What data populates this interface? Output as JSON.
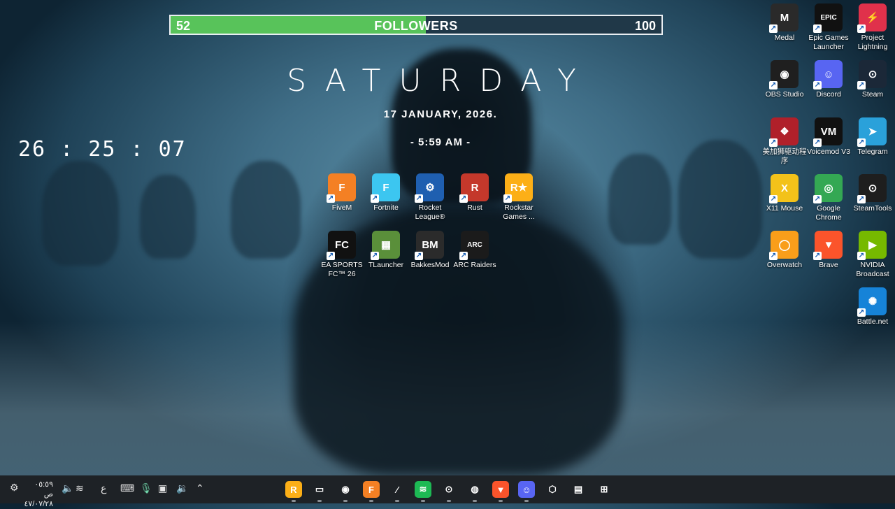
{
  "followers": {
    "current": "52",
    "label": "FOLLOWERS",
    "goal": "100",
    "progress": 0.52
  },
  "widget": {
    "day": "SATURDAY",
    "date": "17 JANUARY, 2026.",
    "time": "- 5:59 AM -"
  },
  "counter": "26 : 25 : 07",
  "center_icons": [
    {
      "label": "FiveM",
      "icon": "fivem-icon",
      "color": "#f48024",
      "glyph": "F"
    },
    {
      "label": "Fortnite",
      "icon": "fortnite-icon",
      "color": "#3cc6f0",
      "glyph": "F"
    },
    {
      "label": "Rocket League®",
      "icon": "rocket-league-icon",
      "color": "#1f5fb0",
      "glyph": "⚙"
    },
    {
      "label": "Rust",
      "icon": "rust-icon",
      "color": "#c4382b",
      "glyph": "R"
    },
    {
      "label": "Rockstar Games ...",
      "icon": "rockstar-icon",
      "color": "#fcaf17",
      "glyph": "R★"
    },
    {
      "label": "EA SPORTS FC™ 26",
      "icon": "ea-fc-icon",
      "color": "#111111",
      "glyph": "FC"
    },
    {
      "label": "TLauncher",
      "icon": "tlauncher-icon",
      "color": "#5a8f3a",
      "glyph": "▦"
    },
    {
      "label": "BakkesMod",
      "icon": "bakkesmod-icon",
      "color": "#2b2b2b",
      "glyph": "BM"
    },
    {
      "label": "ARC Raiders",
      "icon": "arc-raiders-icon",
      "color": "#1b1b1b",
      "glyph": "ARC"
    }
  ],
  "right_icons": [
    {
      "label": "Medal",
      "icon": "medal-icon",
      "color": "#2a2a2a",
      "glyph": "M"
    },
    {
      "label": "Epic Games Launcher",
      "icon": "epic-games-icon",
      "color": "#111111",
      "glyph": "EPIC"
    },
    {
      "label": "Project Lightning",
      "icon": "project-lightning-icon",
      "color": "#e0314b",
      "glyph": "⚡"
    },
    {
      "label": "OBS Studio",
      "icon": "obs-icon",
      "color": "#1f1f1f",
      "glyph": "◉"
    },
    {
      "label": "Discord",
      "icon": "discord-icon",
      "color": "#5865f2",
      "glyph": "☺"
    },
    {
      "label": "Steam",
      "icon": "steam-icon",
      "color": "#1b2838",
      "glyph": "⊙"
    },
    {
      "label": "美加狮驱动程序",
      "icon": "mouse-driver-icon",
      "color": "#b0202a",
      "glyph": "❖"
    },
    {
      "label": "Voicemod V3",
      "icon": "voicemod-icon",
      "color": "#111111",
      "glyph": "VM"
    },
    {
      "label": "Telegram",
      "icon": "telegram-icon",
      "color": "#2aa1da",
      "glyph": "➤"
    },
    {
      "label": "X11 Mouse",
      "icon": "x11-mouse-icon",
      "color": "#f3c21a",
      "glyph": "X"
    },
    {
      "label": "Google Chrome",
      "icon": "chrome-icon",
      "color": "#34a853",
      "glyph": "◎"
    },
    {
      "label": "SteamTools",
      "icon": "steamtools-icon",
      "color": "#1e1e1e",
      "glyph": "⊙"
    },
    {
      "label": "Overwatch",
      "icon": "overwatch-icon",
      "color": "#f99e1a",
      "glyph": "◯"
    },
    {
      "label": "Brave",
      "icon": "brave-icon",
      "color": "#fb542b",
      "glyph": "▼"
    },
    {
      "label": "NVIDIA Broadcast",
      "icon": "nvidia-broadcast-icon",
      "color": "#76b900",
      "glyph": "▶"
    },
    {
      "label": "Battle.net",
      "icon": "battlenet-icon",
      "color": "#1683d8",
      "glyph": "✺"
    }
  ],
  "taskbar": {
    "apps": [
      {
        "name": "rockstar-taskbar-icon",
        "color": "#fcaf17",
        "glyph": "R"
      },
      {
        "name": "voicemod-taskbar-icon",
        "color": "#1e2226",
        "glyph": "▭"
      },
      {
        "name": "obs-taskbar-icon",
        "color": "#1e2226",
        "glyph": "◉"
      },
      {
        "name": "fivem-taskbar-icon",
        "color": "#f48024",
        "glyph": "F"
      },
      {
        "name": "x11-mouse-taskbar-icon",
        "color": "#1e2226",
        "glyph": "⁄"
      },
      {
        "name": "spotify-taskbar-icon",
        "color": "#1db954",
        "glyph": "≋"
      },
      {
        "name": "steam-taskbar-icon",
        "color": "#1e2226",
        "glyph": "⊙"
      },
      {
        "name": "steamtools-taskbar-icon",
        "color": "#1e2226",
        "glyph": "◍"
      },
      {
        "name": "brave-taskbar-icon",
        "color": "#fb542b",
        "glyph": "▼"
      },
      {
        "name": "discord-taskbar-icon",
        "color": "#5865f2",
        "glyph": "☺"
      },
      {
        "name": "app-taskbar-icon",
        "color": "#1e2226",
        "glyph": "⬡"
      },
      {
        "name": "store-taskbar-icon",
        "color": "#1e2226",
        "glyph": "▤"
      },
      {
        "name": "start-taskbar-icon",
        "color": "#1e2226",
        "glyph": "⊞"
      }
    ],
    "clock_time": "٠٥:٥٩ ص",
    "clock_date": "٤٧/٠٧/٢٨",
    "lang": "ع"
  }
}
